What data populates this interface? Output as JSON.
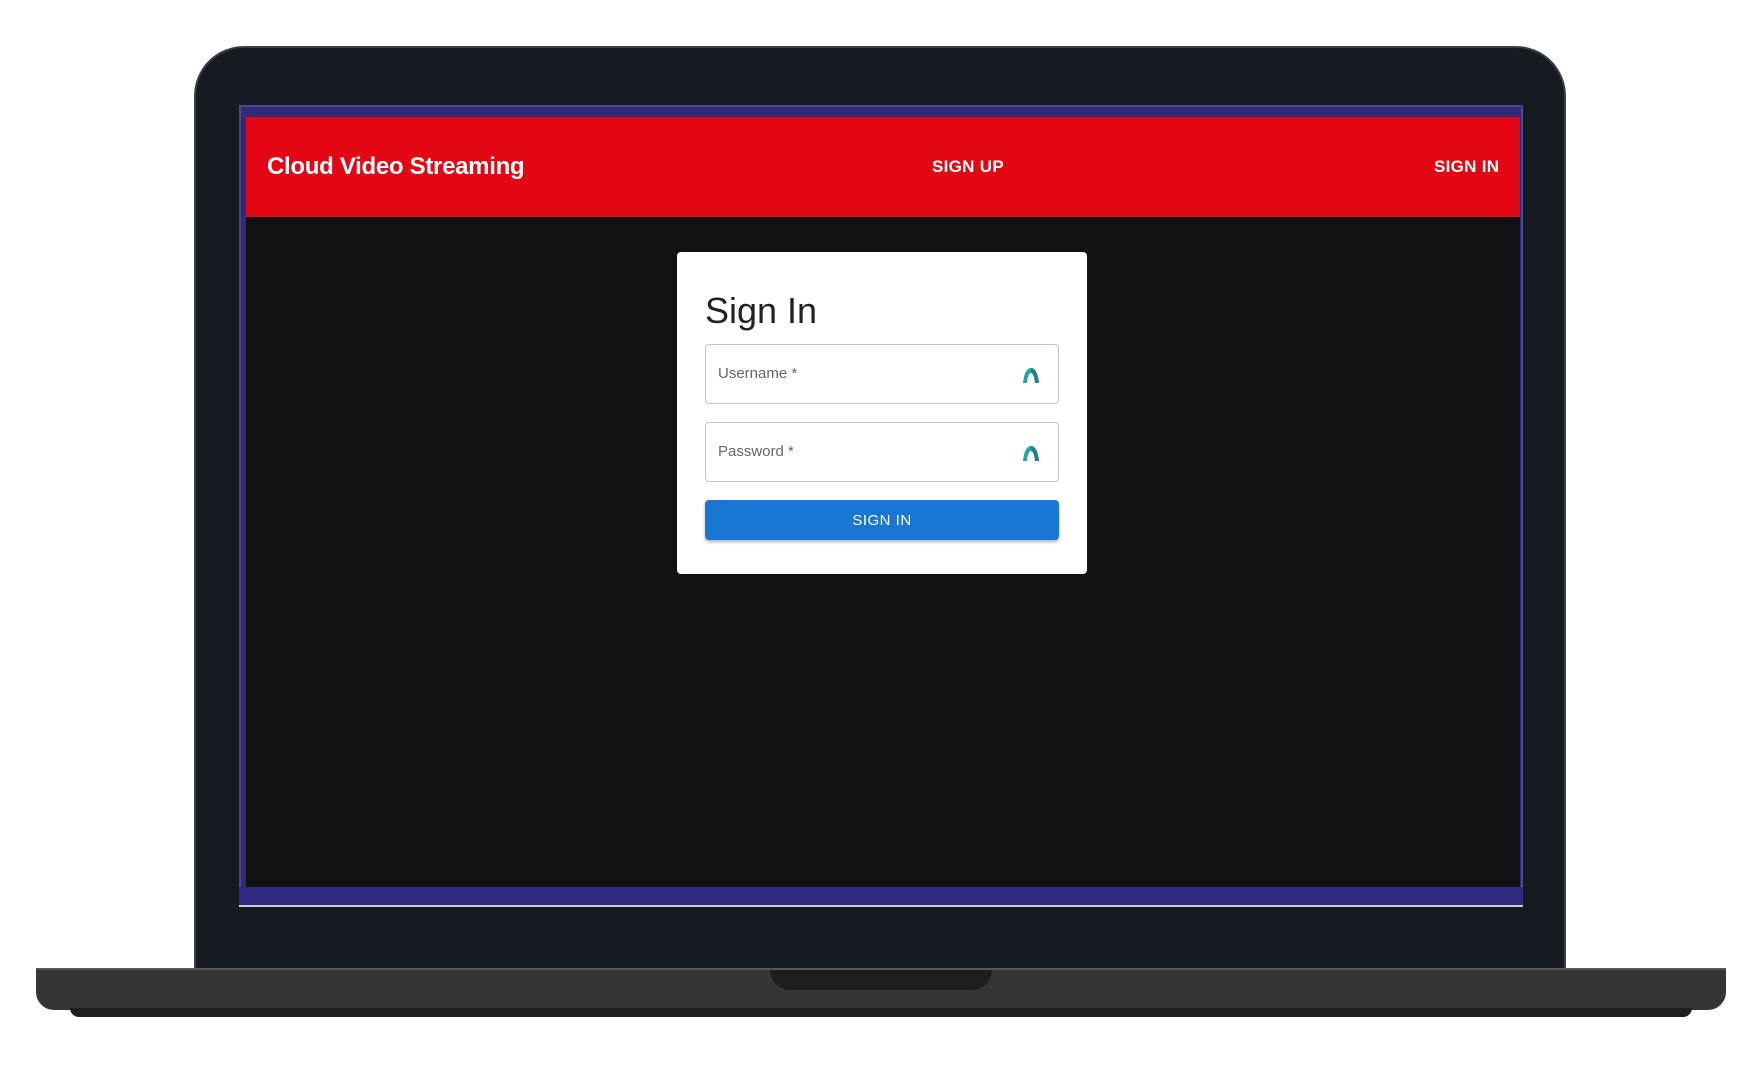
{
  "app": {
    "title": "Cloud Video Streaming"
  },
  "nav": {
    "sign_up_label": "SIGN UP",
    "sign_in_label": "SIGN IN"
  },
  "form": {
    "heading": "Sign In",
    "username_label": "Username *",
    "password_label": "Password *",
    "submit_label": "SIGN IN",
    "field_icon": "password-manager-icon"
  },
  "colors": {
    "header_background": "#e30613",
    "page_background": "#121212",
    "button_background": "#1976d2",
    "icon_color": "#26a69a"
  }
}
